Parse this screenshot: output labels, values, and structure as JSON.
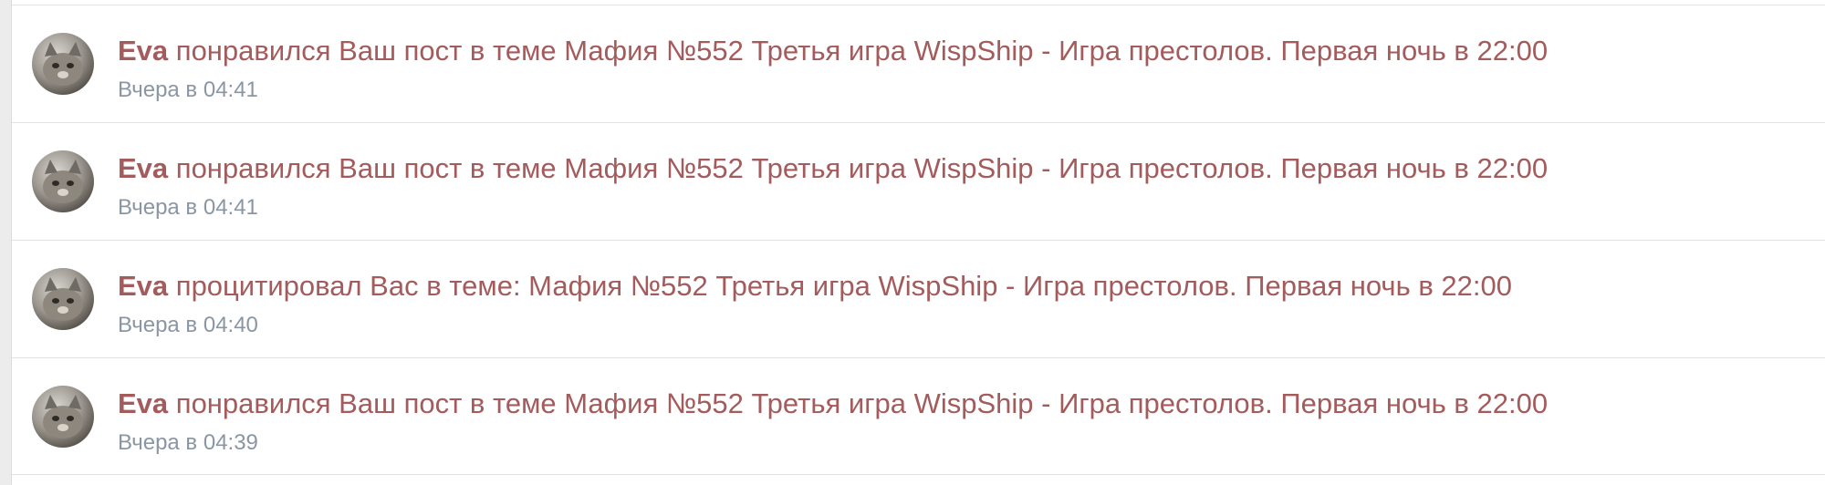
{
  "notifications": [
    {
      "author": "Eva",
      "text": " понравился Ваш пост в теме Мафия №552 Третья игра WispShip - Игра престолов. Первая ночь в 22:00",
      "time": "Вчера в 04:41"
    },
    {
      "author": "Eva",
      "text": " понравился Ваш пост в теме Мафия №552 Третья игра WispShip - Игра престолов. Первая ночь в 22:00",
      "time": "Вчера в 04:41"
    },
    {
      "author": "Eva",
      "text": " процитировал Вас в теме: Мафия №552 Третья игра WispShip - Игра престолов. Первая ночь в 22:00",
      "time": "Вчера в 04:40"
    },
    {
      "author": "Eva",
      "text": " понравился Ваш пост в теме Мафия №552 Третья игра WispShip - Игра престолов. Первая ночь в 22:00",
      "time": "Вчера в 04:39"
    }
  ],
  "colors": {
    "link": "#a35b5c",
    "timestamp": "#8a96a3",
    "divider": "#e2e2e2"
  }
}
